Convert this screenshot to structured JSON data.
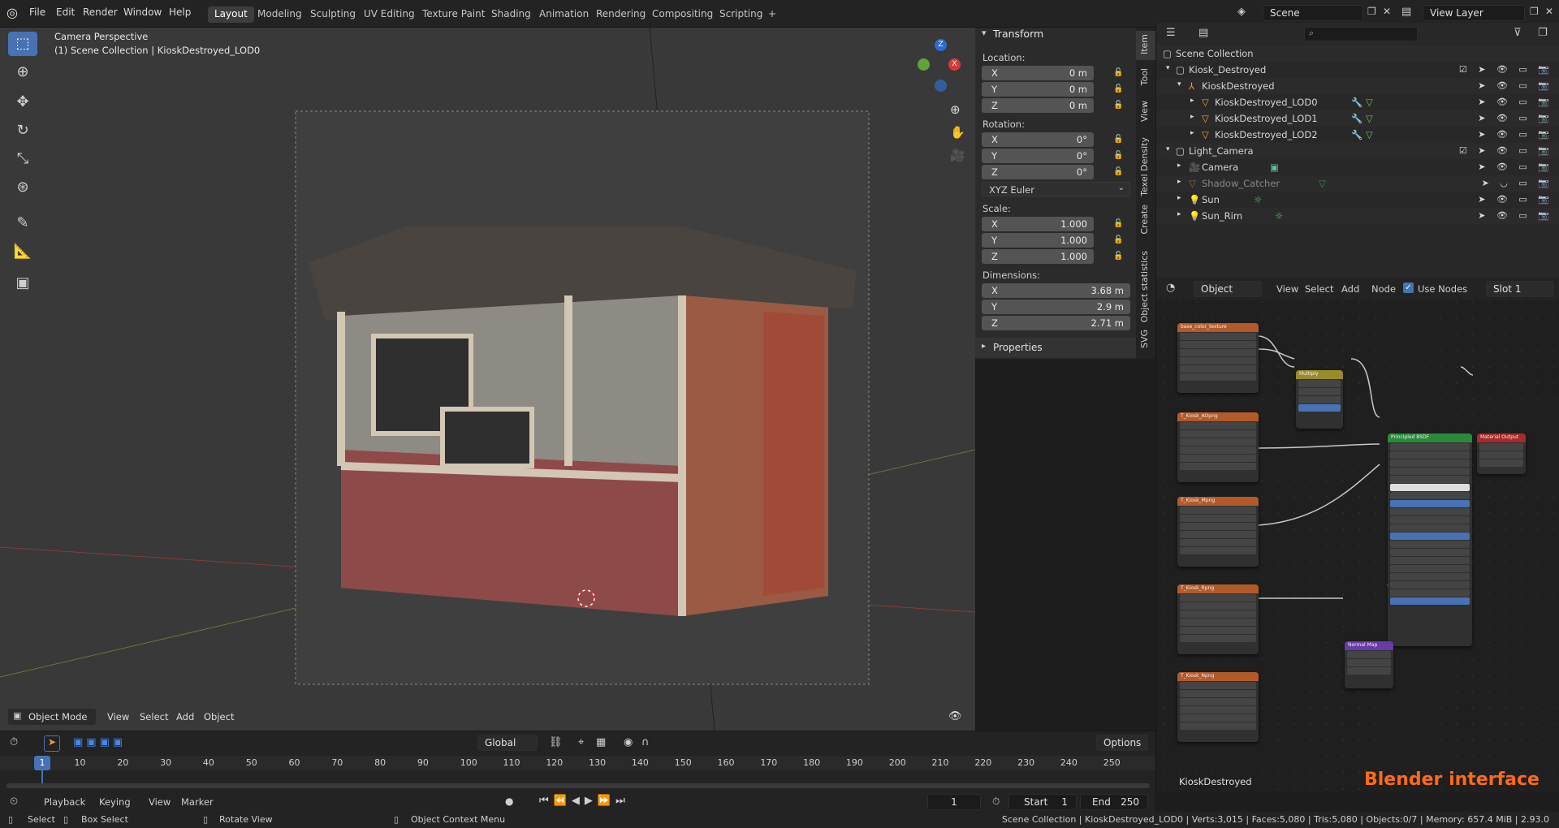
{
  "topbar": {
    "menu": [
      "File",
      "Edit",
      "Render",
      "Window",
      "Help"
    ],
    "workspaces": [
      "Layout",
      "Modeling",
      "Sculpting",
      "UV Editing",
      "Texture Paint",
      "Shading",
      "Animation",
      "Rendering",
      "Compositing",
      "Scripting"
    ],
    "active_workspace": "Layout",
    "add_tab": "+",
    "scene": "Scene",
    "view_layer": "View Layer"
  },
  "viewport": {
    "perspective_label": "Camera Perspective",
    "collection_label": "(1) Scene Collection | KioskDestroyed_LOD0",
    "header_mode": "Object Mode",
    "header_menus": [
      "View",
      "Select",
      "Add",
      "Object"
    ],
    "gizmo": {
      "x": "X",
      "y": "Y",
      "z": "Z"
    }
  },
  "npanel": {
    "transform_title": "Transform",
    "location_label": "Location:",
    "location": [
      {
        "axis": "X",
        "value": "0 m"
      },
      {
        "axis": "Y",
        "value": "0 m"
      },
      {
        "axis": "Z",
        "value": "0 m"
      }
    ],
    "rotation_label": "Rotation:",
    "rotation": [
      {
        "axis": "X",
        "value": "0°"
      },
      {
        "axis": "Y",
        "value": "0°"
      },
      {
        "axis": "Z",
        "value": "0°"
      }
    ],
    "rotation_mode": "XYZ Euler",
    "scale_label": "Scale:",
    "scale": [
      {
        "axis": "X",
        "value": "1.000"
      },
      {
        "axis": "Y",
        "value": "1.000"
      },
      {
        "axis": "Z",
        "value": "1.000"
      }
    ],
    "dimensions_label": "Dimensions:",
    "dimensions": [
      {
        "axis": "X",
        "value": "3.68 m"
      },
      {
        "axis": "Y",
        "value": "2.9 m"
      },
      {
        "axis": "Z",
        "value": "2.71 m"
      }
    ],
    "properties_title": "Properties",
    "tabs": [
      "Item",
      "Tool",
      "View",
      "Texel Density",
      "Create",
      "Object statistics",
      "SVG"
    ]
  },
  "outliner": {
    "search_placeholder": "",
    "rows": [
      {
        "name": "Scene Collection",
        "indent": 0
      },
      {
        "name": "Kiosk_Destroyed",
        "indent": 1
      },
      {
        "name": "KioskDestroyed",
        "indent": 2
      },
      {
        "name": "KioskDestroyed_LOD0",
        "indent": 3
      },
      {
        "name": "KioskDestroyed_LOD1",
        "indent": 3
      },
      {
        "name": "KioskDestroyed_LOD2",
        "indent": 3
      },
      {
        "name": "Light_Camera",
        "indent": 1
      },
      {
        "name": "Camera",
        "indent": 2
      },
      {
        "name": "Shadow_Catcher",
        "indent": 2
      },
      {
        "name": "Sun",
        "indent": 2
      },
      {
        "name": "Sun_Rim",
        "indent": 2
      }
    ]
  },
  "node_editor": {
    "object_dropdown": "Object",
    "menus": [
      "View",
      "Select",
      "Add",
      "Node"
    ],
    "use_nodes": "Use Nodes",
    "slot": "Slot 1",
    "material_name": "KioskDestroyed",
    "watermark": "Blender interface",
    "nodes": [
      {
        "title": "base_color_texture",
        "color": "#b35a2a"
      },
      {
        "title": "T_Kiosk_AOpng",
        "color": "#b35a2a"
      },
      {
        "title": "T_Kiosk_Mpng",
        "color": "#b35a2a"
      },
      {
        "title": "T_Kiosk_Rpng",
        "color": "#b35a2a"
      },
      {
        "title": "T_Kiosk_Npng",
        "color": "#b35a2a"
      },
      {
        "title": "Multiply",
        "color": "#9a8b2a"
      },
      {
        "title": "Principled BSDF",
        "color": "#2a8a3a"
      },
      {
        "title": "Material Output",
        "color": "#a82a2a"
      },
      {
        "title": "Normal Map",
        "color": "#6a3aa8"
      }
    ]
  },
  "timeline": {
    "menus": [
      "Playback",
      "Keying",
      "View",
      "Marker"
    ],
    "header_mode": "Global",
    "options": "Options",
    "current_frame": "1",
    "start_label": "Start",
    "start": "1",
    "end_label": "End",
    "end": "250",
    "ticks": [
      "1",
      "10",
      "20",
      "30",
      "40",
      "50",
      "60",
      "70",
      "80",
      "90",
      "100",
      "110",
      "120",
      "130",
      "140",
      "150",
      "160",
      "170",
      "180",
      "190",
      "200",
      "210",
      "220",
      "230",
      "240",
      "250"
    ]
  },
  "statusbar": {
    "left": [
      "Select",
      "Box Select",
      "Rotate View",
      "Object Context Menu"
    ],
    "right": "Scene Collection | KioskDestroyed_LOD0 | Verts:3,015 | Faces:5,080 | Tris:5,080 | Objects:0/7 | Memory: 657.4 MiB | 2.93.0"
  },
  "colors": {
    "accent": "#4772b3",
    "watermark": "#ff6a1a",
    "header": "#232323"
  }
}
